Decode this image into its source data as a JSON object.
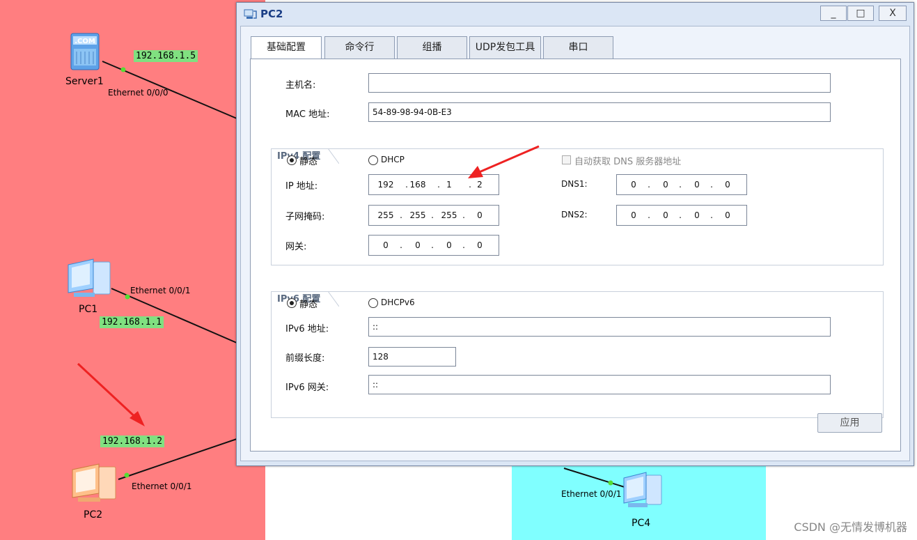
{
  "topology": {
    "devices": {
      "server1": "Server1",
      "pc1": "PC1",
      "pc2": "PC2",
      "pc4": "PC4"
    },
    "ports": {
      "server1": "Ethernet 0/0/0",
      "pc1": "Ethernet 0/0/1",
      "pc2": "Ethernet 0/0/1",
      "pc4": "Ethernet 0/0/1"
    },
    "ips": {
      "server1": "192.168.1.5",
      "pc1": "192.168.1.1",
      "pc2": "192.168.1.2"
    },
    "zone_colors": {
      "red": "#ff7e80",
      "cyan": "#80ffff",
      "ip_tag": "#80e080"
    }
  },
  "window": {
    "title": "PC2",
    "buttons": {
      "minimize": "_",
      "maximize": "□",
      "close": "X"
    },
    "tabs": [
      "基础配置",
      "命令行",
      "组播",
      "UDP发包工具",
      "串口"
    ],
    "active_tab": "基础配置",
    "form": {
      "hostname_label": "主机名:",
      "hostname_value": "",
      "mac_label": "MAC 地址:",
      "mac_value": "54-89-98-94-0B-E3",
      "ipv4": {
        "title": "IPv4 配置",
        "static_label": "静态",
        "dhcp_label": "DHCP",
        "static_selected": true,
        "auto_dns_label": "自动获取 DNS 服务器地址",
        "auto_dns_checked": false,
        "ip_label": "IP 地址:",
        "ip": [
          "192",
          "168",
          "1",
          "2"
        ],
        "mask_label": "子网掩码:",
        "mask": [
          "255",
          "255",
          "255",
          "0"
        ],
        "gateway_label": "网关:",
        "gateway": [
          "0",
          "0",
          "0",
          "0"
        ],
        "dns1_label": "DNS1:",
        "dns1": [
          "0",
          "0",
          "0",
          "0"
        ],
        "dns2_label": "DNS2:",
        "dns2": [
          "0",
          "0",
          "0",
          "0"
        ]
      },
      "ipv6": {
        "title": "IPv6 配置",
        "static_label": "静态",
        "dhcp_label": "DHCPv6",
        "static_selected": true,
        "ip_label": "IPv6 地址:",
        "ip_value": "::",
        "prefix_label": "前缀长度:",
        "prefix_value": "128",
        "gateway_label": "IPv6 网关:",
        "gateway_value": "::"
      },
      "apply_label": "应用"
    }
  },
  "annotation_color": "#ee2222",
  "watermark": "CSDN @无情发博机器"
}
